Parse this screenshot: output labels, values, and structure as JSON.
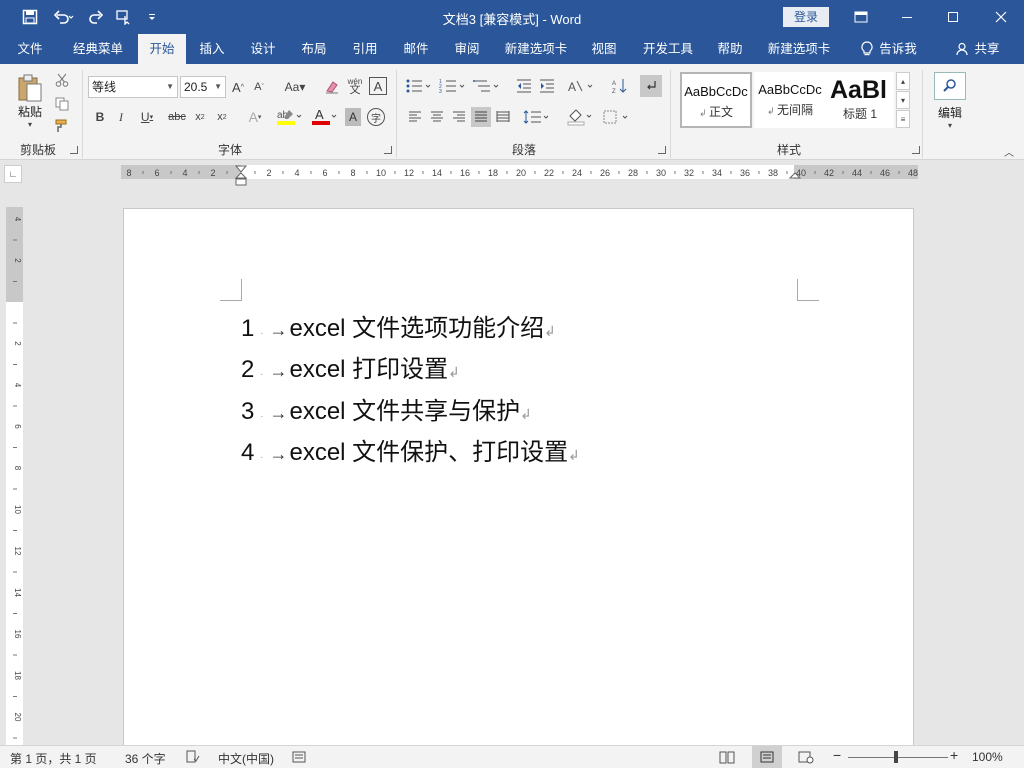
{
  "window": {
    "title": "文档3 [兼容模式] - Word",
    "login": "登录"
  },
  "tabs": [
    {
      "label": "文件"
    },
    {
      "label": "经典菜单"
    },
    {
      "label": "开始"
    },
    {
      "label": "插入"
    },
    {
      "label": "设计"
    },
    {
      "label": "布局"
    },
    {
      "label": "引用"
    },
    {
      "label": "邮件"
    },
    {
      "label": "审阅"
    },
    {
      "label": "新建选项卡"
    },
    {
      "label": "视图"
    },
    {
      "label": "开发工具"
    },
    {
      "label": "帮助"
    },
    {
      "label": "新建选项卡"
    },
    {
      "label": "告诉我"
    },
    {
      "label": "共享"
    }
  ],
  "ribbon": {
    "paste_label": "粘贴",
    "groups": {
      "clipboard": "剪贴板",
      "font": "字体",
      "paragraph": "段落",
      "styles": "样式",
      "editing": "编辑"
    },
    "font_name": "等线",
    "font_size": "20.5",
    "styles": [
      {
        "preview": "AaBbCcDc",
        "name": "正文"
      },
      {
        "preview": "AaBbCcDc",
        "name": "无间隔"
      },
      {
        "preview": "AaBl",
        "name": "标题 1"
      }
    ],
    "phonetic_label": "wén"
  },
  "ruler": {
    "h_ticks": [
      "8",
      "6",
      "4",
      "2",
      "",
      "2",
      "4",
      "6",
      "8",
      "10",
      "12",
      "14",
      "16",
      "18",
      "20",
      "22",
      "24",
      "26",
      "28",
      "30",
      "32",
      "34",
      "36",
      "38",
      "40",
      "42",
      "44",
      "46",
      "48"
    ],
    "v_ticks": [
      "4",
      "2",
      "",
      "2",
      "4",
      "6",
      "8",
      "10",
      "12",
      "14",
      "16",
      "18",
      "20"
    ]
  },
  "document": {
    "items": [
      {
        "num": "1",
        "text": "excel 文件选项功能介绍"
      },
      {
        "num": "2",
        "text": "excel 打印设置"
      },
      {
        "num": "3",
        "text": "excel 文件共享与保护"
      },
      {
        "num": "4",
        "text": "excel 文件保护、打印设置"
      }
    ]
  },
  "status": {
    "page": "第 1 页，共 1 页",
    "words": "36 个字",
    "language": "中文(中国)",
    "zoom": "100%"
  },
  "colors": {
    "accent": "#2b579a",
    "ribbon_bg": "#f3f3f3",
    "canvas_bg": "#e6e6e6"
  }
}
